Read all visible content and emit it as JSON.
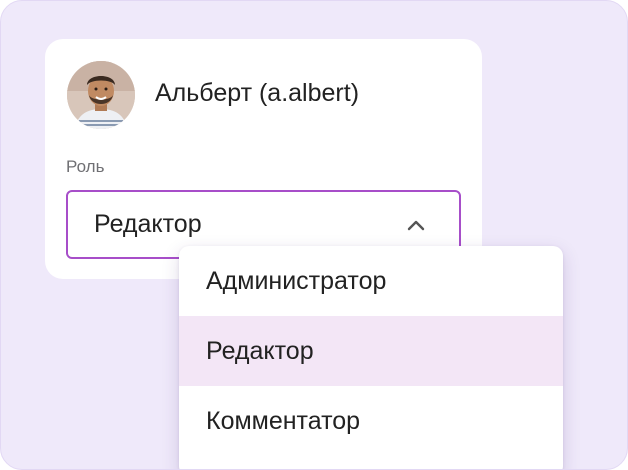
{
  "user": {
    "name": "Альберт (a.albert)"
  },
  "role": {
    "label": "Роль",
    "selected": "Редактор",
    "options": [
      {
        "label": "Администратор",
        "selected": false
      },
      {
        "label": "Редактор",
        "selected": true
      },
      {
        "label": "Комментатор",
        "selected": false
      }
    ]
  },
  "icons": {
    "avatar": "user-photo",
    "dropdown": "chevron-up-icon"
  },
  "colors": {
    "backdrop": "#efe9fa",
    "accent_border": "#a74ec9",
    "selected_item_bg": "#f3e6f6"
  }
}
